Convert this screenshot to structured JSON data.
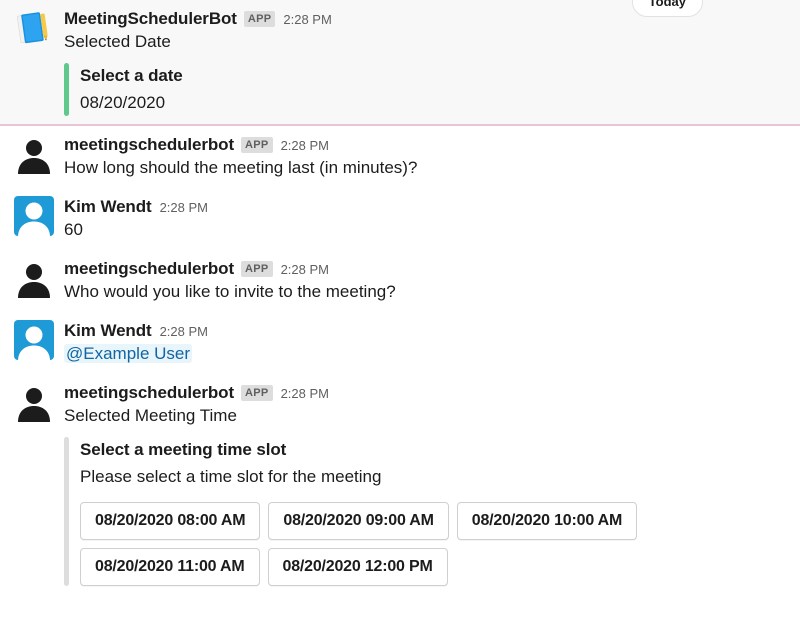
{
  "date_divider": {
    "label": "Today"
  },
  "messages": [
    {
      "id": "selected-date",
      "sender": "MeetingSchedulerBot",
      "badge": "APP",
      "timestamp": "2:28 PM",
      "avatar": "notebook-emoji-avatar",
      "text": "Selected Date",
      "attachment": {
        "title": "Select a date",
        "subtitle": "08/20/2020",
        "bar_color": "#5fc98d"
      }
    },
    {
      "id": "ask-duration",
      "sender": "meetingschedulerbot",
      "badge": "APP",
      "timestamp": "2:28 PM",
      "avatar": "bot-silhouette-avatar",
      "text": "How long should the meeting last (in minutes)?"
    },
    {
      "id": "reply-duration",
      "sender": "Kim Wendt",
      "badge": "",
      "timestamp": "2:28 PM",
      "avatar": "user-silhouette-avatar",
      "text": "60"
    },
    {
      "id": "ask-invitees",
      "sender": "meetingschedulerbot",
      "badge": "APP",
      "timestamp": "2:28 PM",
      "avatar": "bot-silhouette-avatar",
      "text": "Who would you like to invite to the meeting?"
    },
    {
      "id": "reply-invitees",
      "sender": "Kim Wendt",
      "badge": "",
      "timestamp": "2:28 PM",
      "avatar": "user-silhouette-avatar",
      "mention": "@Example User"
    },
    {
      "id": "selected-meeting-time",
      "sender": "meetingschedulerbot",
      "badge": "APP",
      "timestamp": "2:28 PM",
      "avatar": "bot-silhouette-avatar",
      "text": "Selected Meeting Time",
      "attachment": {
        "title": "Select a meeting time slot",
        "subtitle": "Please select a time slot for the meeting",
        "bar_color": "#dddddd",
        "buttons": [
          "08/20/2020 08:00 AM",
          "08/20/2020 09:00 AM",
          "08/20/2020 10:00 AM",
          "08/20/2020 11:00 AM",
          "08/20/2020 12:00 PM"
        ]
      }
    }
  ],
  "colors": {
    "unread_rule": "#e8c5d4",
    "highlight_background": "#f8f8f8",
    "mention_text": "#1264a3",
    "mention_background": "#e8f5fa",
    "user_avatar_blue": "#1e9bd7",
    "attachment_green": "#5fc98d",
    "attachment_gray": "#dddddd"
  }
}
